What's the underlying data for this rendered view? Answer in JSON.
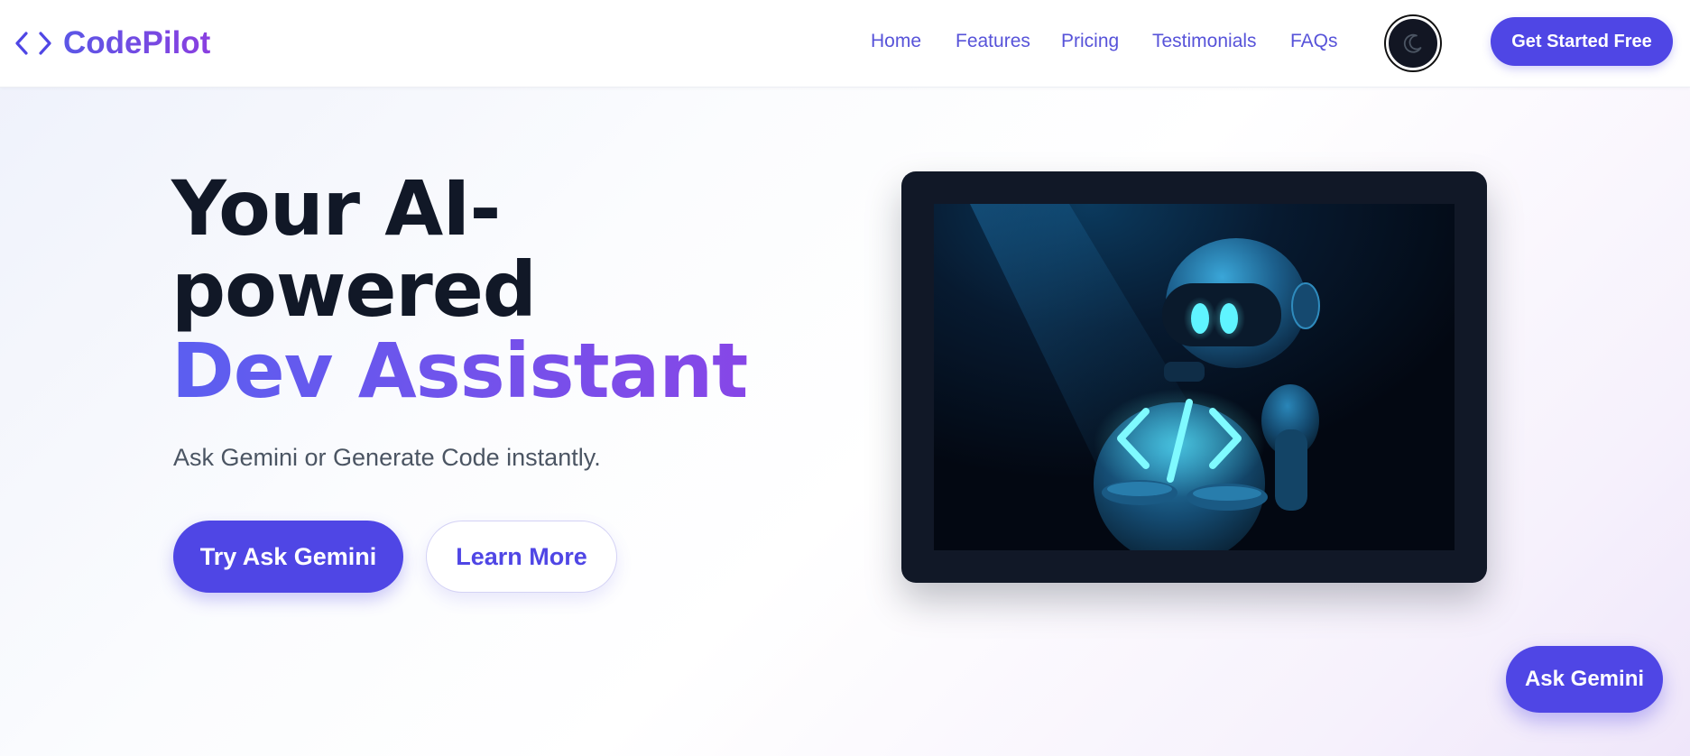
{
  "brand": {
    "name": "CodePilot",
    "logo_icon": "code-brackets-icon",
    "gradient_start": "#5b57e6",
    "gradient_end": "#8a3fe0"
  },
  "nav": {
    "items": [
      {
        "label": "Home"
      },
      {
        "label": "Features"
      },
      {
        "label": "Pricing"
      },
      {
        "label": "Testimonials"
      },
      {
        "label": "FAQs"
      }
    ],
    "theme_toggle_icon": "moon-icon",
    "cta_label": "Get Started Free"
  },
  "hero": {
    "title_line1": "Your AI-",
    "title_line2": "powered",
    "title_highlight": "Dev Assistant",
    "subtitle": "Ask Gemini or Generate Code instantly.",
    "primary_button": "Try Ask Gemini",
    "secondary_button": "Learn More",
    "illustration": "robot-holding-code-icon-illustration"
  },
  "floating": {
    "label": "Ask Gemini"
  },
  "colors": {
    "accent": "#4f46e5",
    "heading": "#111827",
    "body_text": "#4b5563",
    "frame": "#111827"
  }
}
